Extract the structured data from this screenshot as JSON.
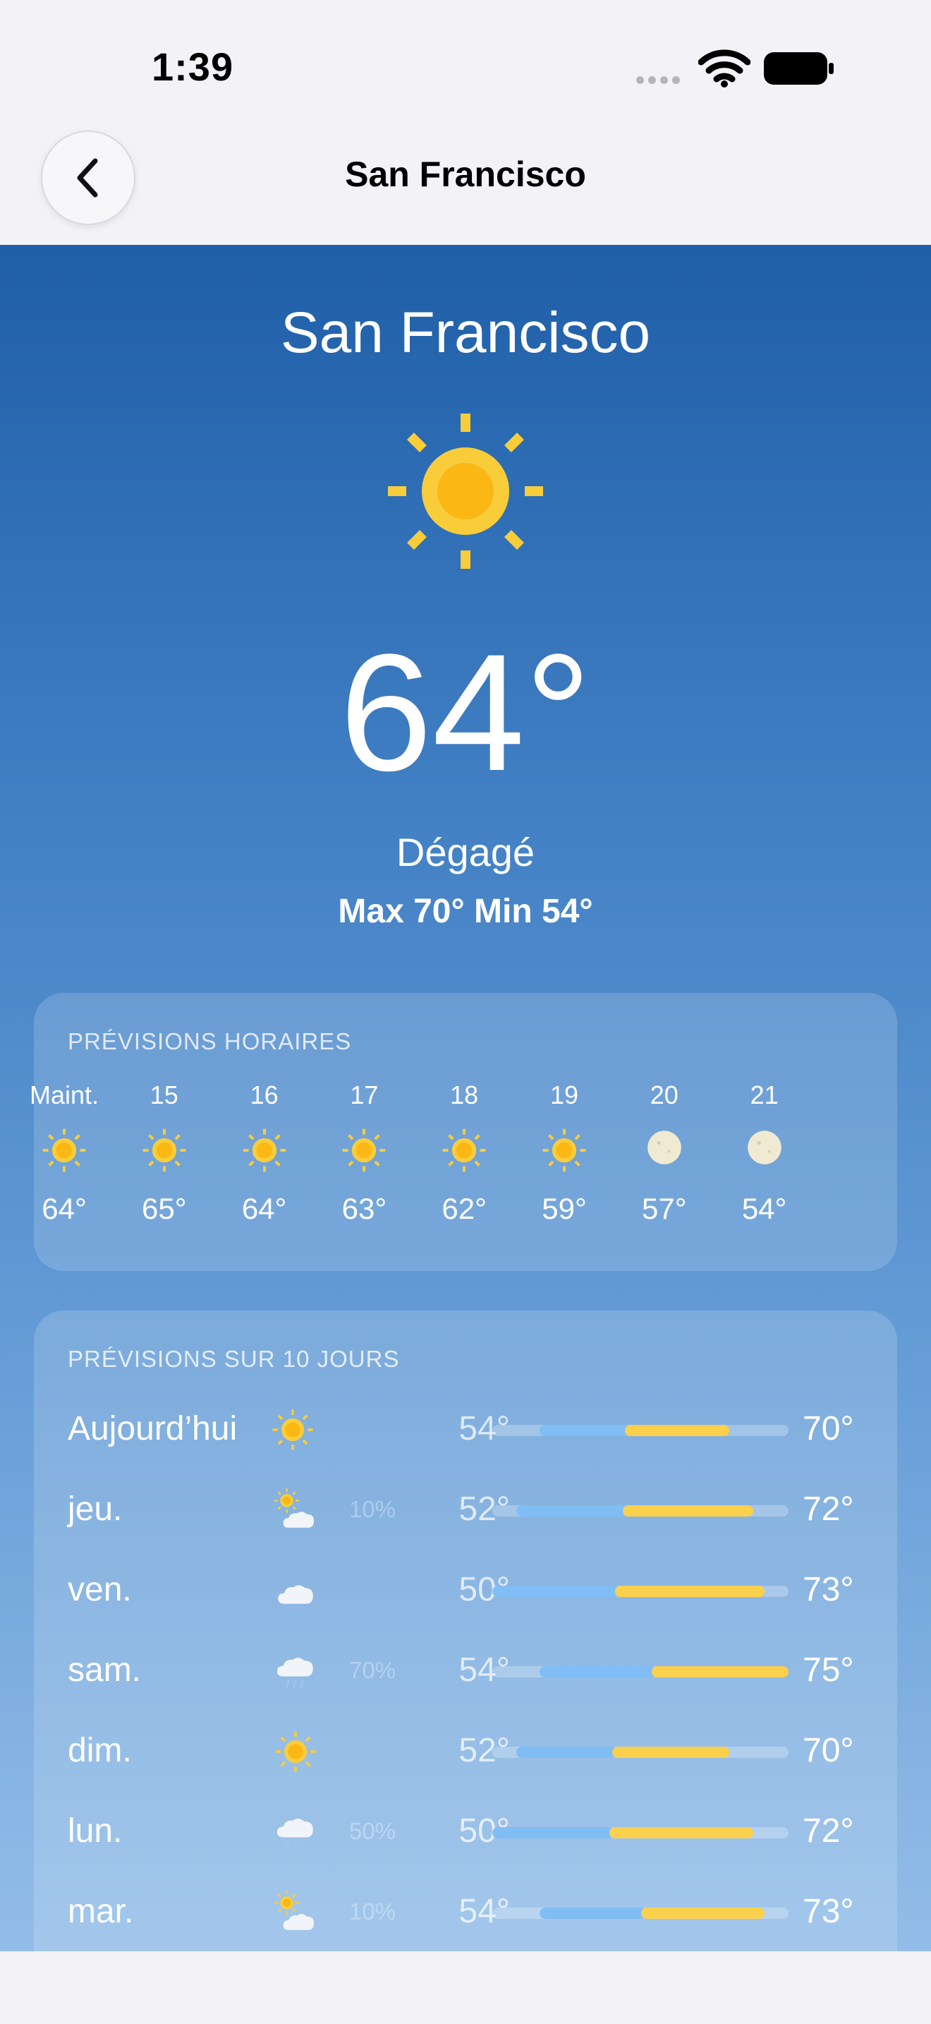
{
  "status_bar": {
    "time": "1:39"
  },
  "nav": {
    "title": "San Francisco",
    "back_icon": "chevron-left-icon"
  },
  "current": {
    "city": "San Francisco",
    "icon": "sun-icon",
    "temperature": "64°",
    "condition": "Dégagé",
    "high_low": "Max 70° Min 54°"
  },
  "hourly": {
    "title": "PRÉVISIONS HORAIRES",
    "items": [
      {
        "time": "Maint.",
        "icon": "sun",
        "temp": "64°"
      },
      {
        "time": "15",
        "icon": "sun",
        "temp": "65°"
      },
      {
        "time": "16",
        "icon": "sun",
        "temp": "64°"
      },
      {
        "time": "17",
        "icon": "sun",
        "temp": "63°"
      },
      {
        "time": "18",
        "icon": "sun",
        "temp": "62°"
      },
      {
        "time": "19",
        "icon": "sun",
        "temp": "59°"
      },
      {
        "time": "20",
        "icon": "moon",
        "temp": "57°"
      },
      {
        "time": "21",
        "icon": "moon",
        "temp": "54°"
      }
    ]
  },
  "daily": {
    "title": "PRÉVISIONS SUR 10 JOURS",
    "range_min": 50,
    "range_max": 75,
    "items": [
      {
        "day": "Aujourd’hui",
        "icon": "sun",
        "precip": "",
        "low": "54°",
        "high": "70°",
        "low_value": 54,
        "high_value": 70
      },
      {
        "day": "jeu.",
        "icon": "partly-cloudy",
        "precip": "10%",
        "low": "52°",
        "high": "72°",
        "low_value": 52,
        "high_value": 72
      },
      {
        "day": "ven.",
        "icon": "cloud",
        "precip": "",
        "low": "50°",
        "high": "73°",
        "low_value": 50,
        "high_value": 73
      },
      {
        "day": "sam.",
        "icon": "rain",
        "precip": "70%",
        "low": "54°",
        "high": "75°",
        "low_value": 54,
        "high_value": 75
      },
      {
        "day": "dim.",
        "icon": "sun",
        "precip": "",
        "low": "52°",
        "high": "70°",
        "low_value": 52,
        "high_value": 70
      },
      {
        "day": "lun.",
        "icon": "rain",
        "precip": "50%",
        "low": "50°",
        "high": "72°",
        "low_value": 50,
        "high_value": 72
      },
      {
        "day": "mar.",
        "icon": "partly-cloudy",
        "precip": "10%",
        "low": "54°",
        "high": "73°",
        "low_value": 54,
        "high_value": 73
      }
    ]
  },
  "colors": {
    "sun": "#f9cd3a",
    "sun_core": "#fbb714",
    "bar_cool": "#80bdf5",
    "bar_warm": "#fbd04c",
    "moon": "#f1ead3"
  }
}
